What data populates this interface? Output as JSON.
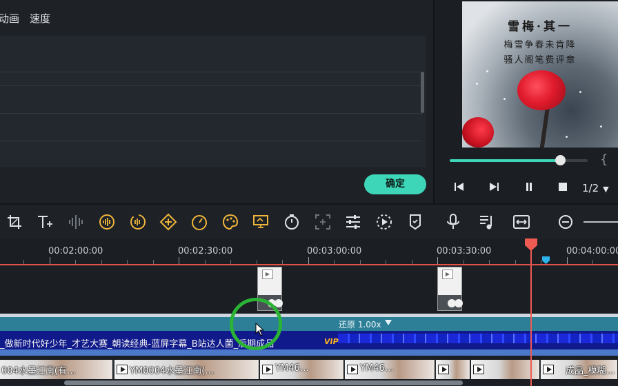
{
  "tabs": [
    "动画",
    "速度"
  ],
  "confirm_label": "确定",
  "preview": {
    "poem_title": "雪梅·其一",
    "poem_line1": "梅雪争春未肯降",
    "poem_line2": "骚人阁笔费评章",
    "progress_fraction": 0.8,
    "page_indicator": "1/2",
    "brace_char": "{",
    "controls": [
      "prev-frame-icon",
      "play-icon",
      "pause-icon",
      "stop-icon"
    ]
  },
  "toolbar": {
    "icons": [
      "crop-icon",
      "text-icon",
      "audio-split-icon",
      "audio-detect-icon",
      "audio-stretch-icon",
      "keyframe-icon",
      "speed-icon",
      "color-icon",
      "green-screen-icon",
      "timer-icon",
      "mosaic-icon",
      "adjust-icon",
      "motion-track-icon",
      "marker-icon",
      "voiceover-icon",
      "music-icon",
      "fit-icon",
      "zoom-out-icon"
    ]
  },
  "ruler": {
    "timecodes": [
      "00:02:00:00",
      "00:02:30:00",
      "00:03:00:00",
      "00:03:30:00",
      "00:04:00:00"
    ]
  },
  "speed_label": "还原 1.00x",
  "title_track": {
    "text": "_做新时代好少年_才艺大赛_朝读经典-蓝屏字幕_B站达人菌_后期成品",
    "badge": "VIP"
  },
  "video_clips": [
    {
      "name": "004水墨江南(有…"
    },
    {
      "name": "YM0004水墨江南(…"
    },
    {
      "name": "YM46…"
    },
    {
      "name": "YM46…"
    },
    {
      "name": ""
    },
    {
      "name": ""
    },
    {
      "name": "成品_模糊…"
    }
  ],
  "colors": {
    "accent": "#3ed6b8",
    "playhead": "#ef5a52",
    "speed_strip": "#2d7f97",
    "title_track": "#101a8a",
    "vip": "#ffb323",
    "click_ring": "#2bb335"
  }
}
